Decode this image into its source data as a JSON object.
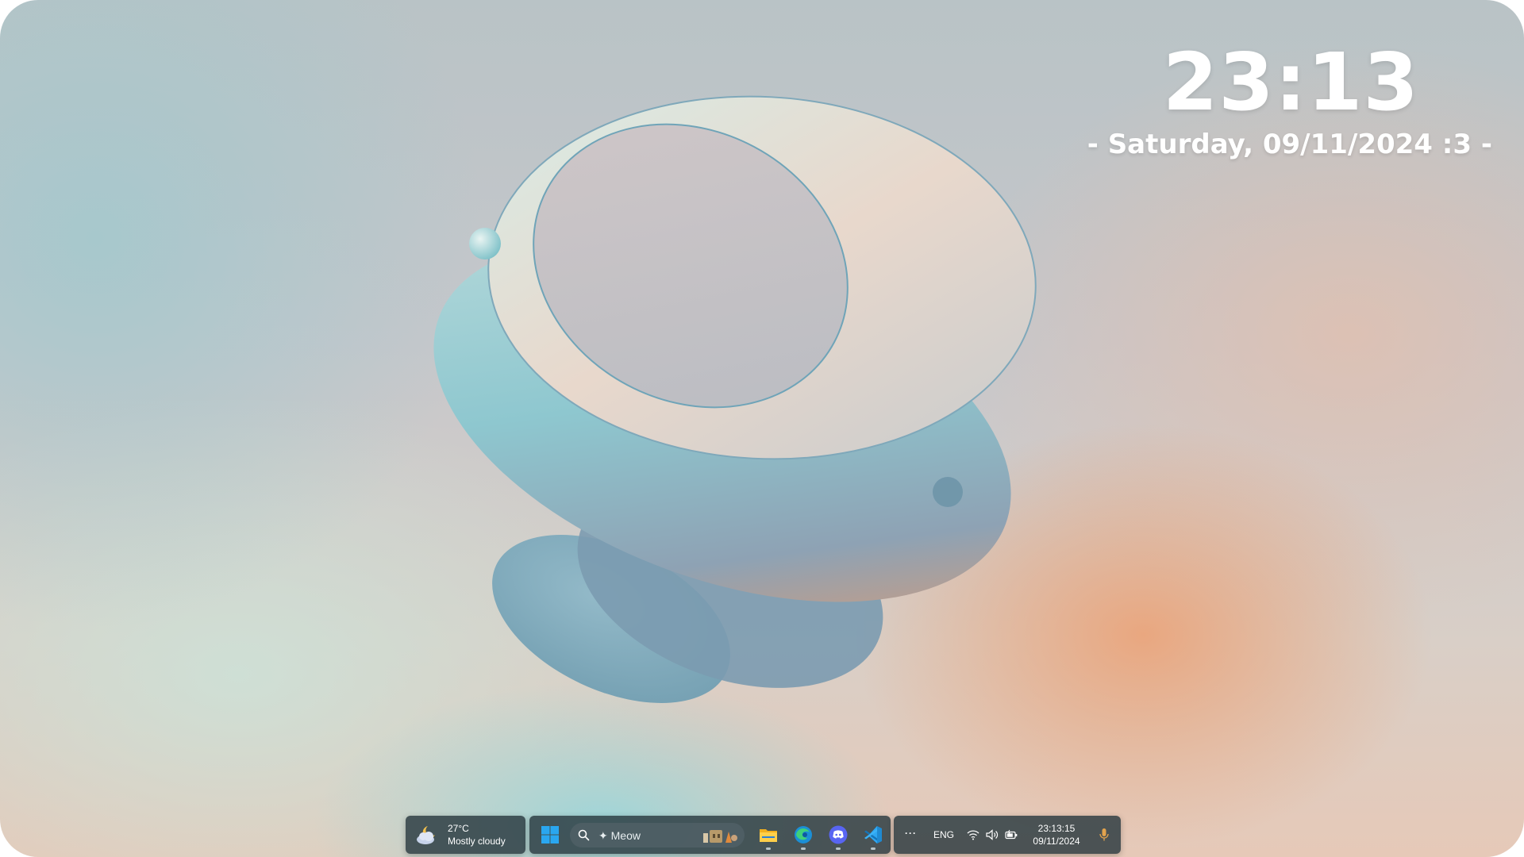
{
  "clock": {
    "time": "23:13",
    "date": "- Saturday, 09/11/2024  :3 -"
  },
  "taskbar": {
    "weather": {
      "temperature": "27°C",
      "condition": "Mostly cloudy",
      "icon": "partly-cloudy-night-icon"
    },
    "start_icon": "windows-start-icon",
    "search": {
      "text": "✦ Meow",
      "icon": "search-icon",
      "highlight_icon": "search-highlight-image"
    },
    "pinned_apps": [
      {
        "name": "File Explorer",
        "icon": "folder-icon",
        "running": true
      },
      {
        "name": "Microsoft Edge",
        "icon": "edge-icon",
        "running": true
      },
      {
        "name": "Discord",
        "icon": "discord-icon",
        "running": true
      },
      {
        "name": "Visual Studio Code",
        "icon": "vscode-icon",
        "running": true
      }
    ],
    "tray": {
      "overflow_label": "···",
      "language": "ENG",
      "icons": [
        "wifi-icon",
        "volume-icon",
        "battery-icon",
        "microphone-icon"
      ],
      "time": "23:13:15",
      "date": "09/11/2024"
    }
  },
  "colors": {
    "taskbar_bg": "#28383e",
    "accent_blue": "#2aa7f0",
    "clock_text": "#ffffff",
    "mic_orange": "#e2a34d"
  }
}
